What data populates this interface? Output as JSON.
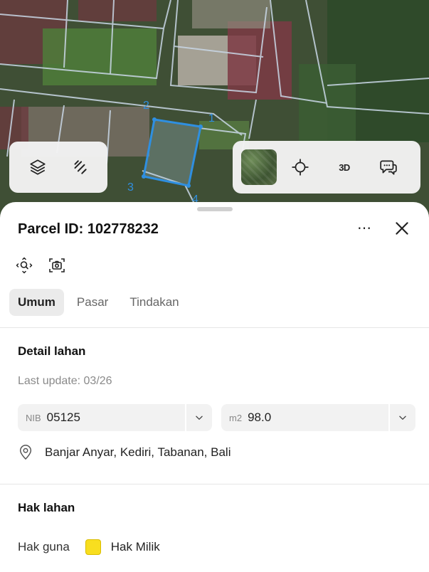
{
  "map": {
    "vertex_labels": [
      "1",
      "2",
      "3",
      "4"
    ],
    "highlight_color": "#2f8fe0",
    "toolbar_left": {
      "icons": [
        "layers-icon",
        "draw-lines-icon"
      ]
    },
    "toolbar_right": {
      "icons": [
        "satellite-thumbnail",
        "locate-icon",
        "3d-toggle",
        "feedback-icon"
      ],
      "label_3d": "3D"
    }
  },
  "sheet": {
    "title": "Parcel ID: 102778232",
    "more_label": "⋯",
    "tool_icons": [
      "zoom-to-parcel-icon",
      "screenshot-icon"
    ],
    "tabs": [
      {
        "label": "Umum",
        "active": true
      },
      {
        "label": "Pasar",
        "active": false
      },
      {
        "label": "Tindakan",
        "active": false
      }
    ],
    "detail": {
      "heading": "Detail lahan",
      "last_update": "Last update: 03/26",
      "nib_label": "NIB",
      "nib_value": "05125",
      "area_label": "m2",
      "area_value": "98.0",
      "address": "Banjar Anyar, Kediri, Tabanan, Bali"
    },
    "rights": {
      "heading": "Hak lahan",
      "key": "Hak guna",
      "value": "Hak Milik",
      "swatch_color": "#f8de1f"
    }
  }
}
